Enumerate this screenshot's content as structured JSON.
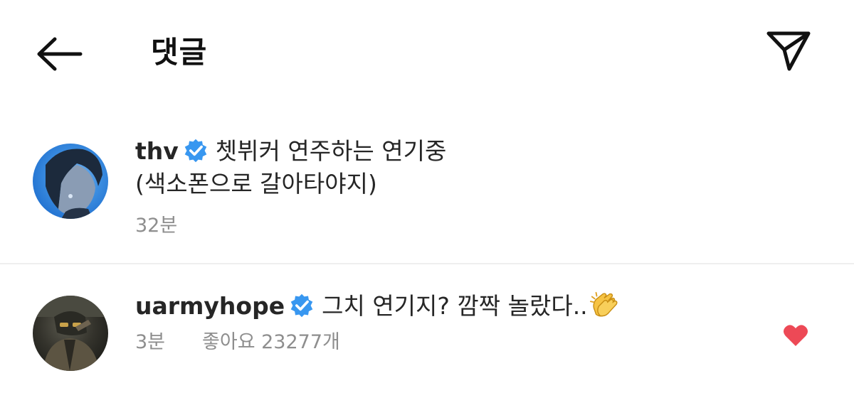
{
  "header": {
    "back_icon": "arrow-left-icon",
    "title": "댓글",
    "send_icon": "paper-plane-icon"
  },
  "comments": [
    {
      "username": "thv",
      "verified": true,
      "text_line1": "쳇뷔커 연주하는 연기중",
      "text_line2": "(색소폰으로 갈아타야지)",
      "time": "32분",
      "avatar_color": "#3b8de0"
    },
    {
      "username": "uarmyhope",
      "verified": true,
      "text": "그치 연기지? 깜짝 놀랐다..",
      "emoji": "clapping-hands-icon",
      "time": "3분",
      "likes": "좋아요 23277개",
      "liked": true,
      "avatar_color": "#34332c"
    }
  ],
  "colors": {
    "verified_badge": "#3897f0",
    "like_heart": "#ed4956",
    "meta_text": "#8e8e8e",
    "divider": "#efefef"
  }
}
